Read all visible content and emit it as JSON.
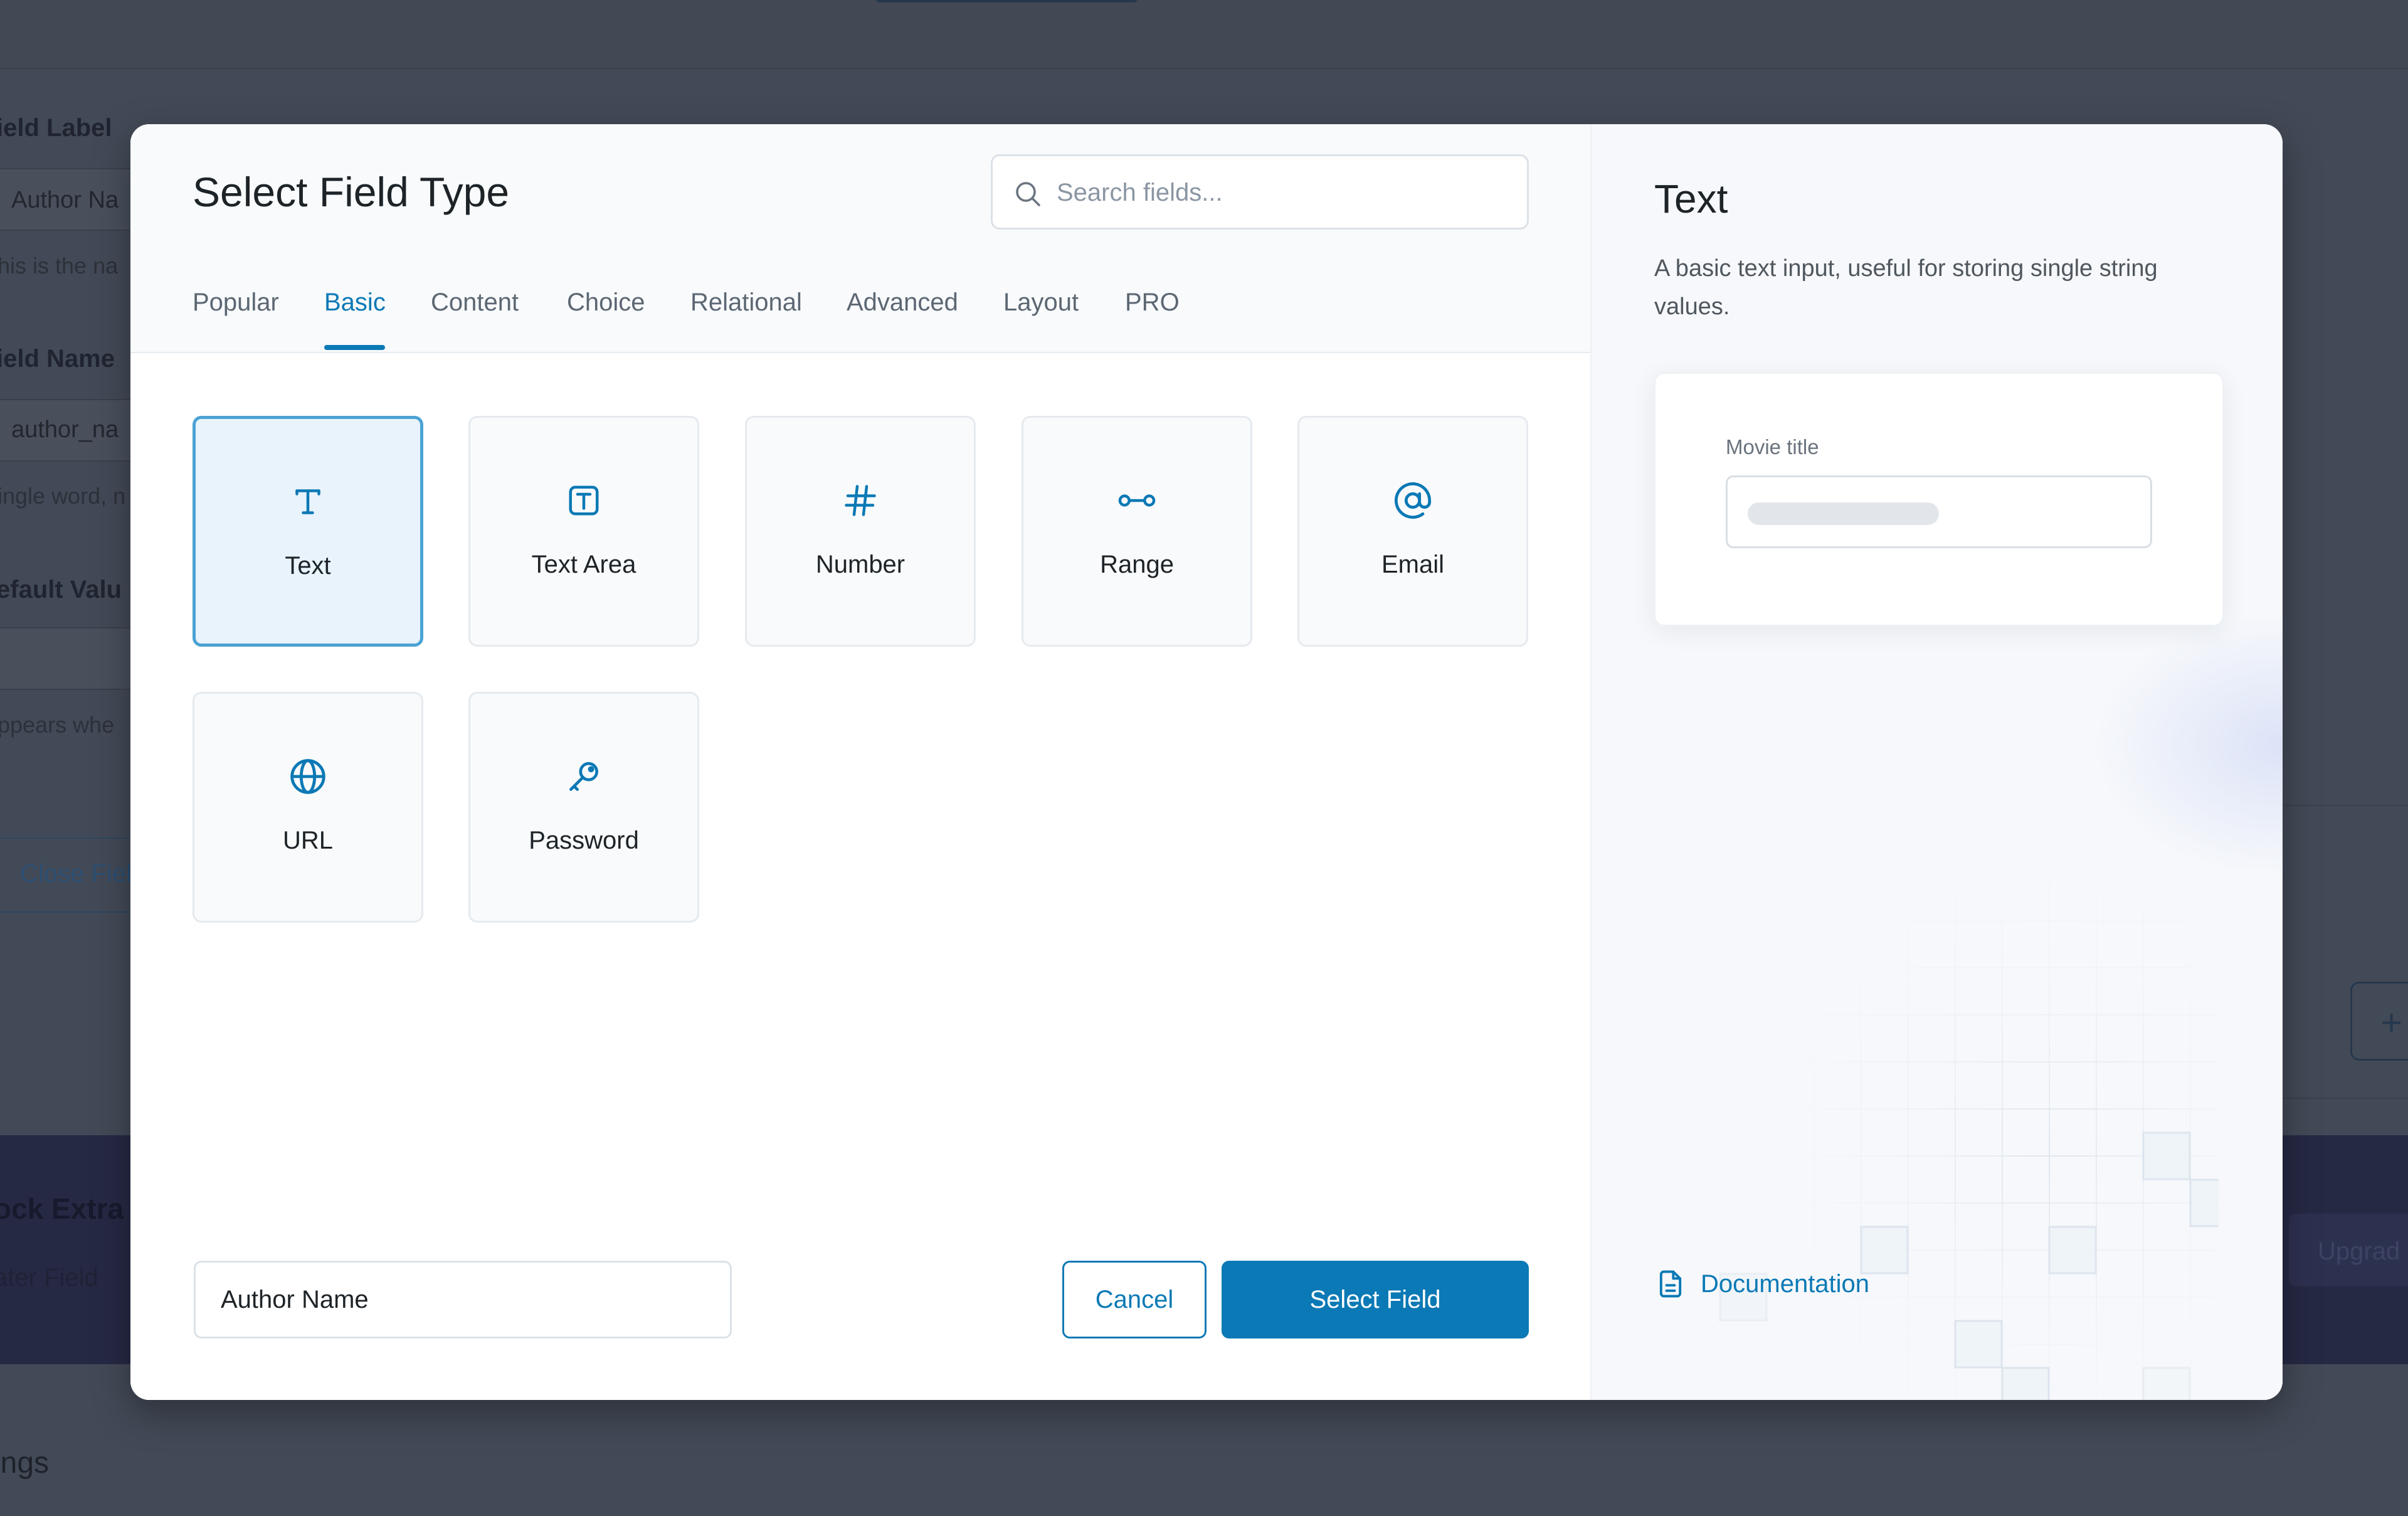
{
  "background": {
    "labels": {
      "field_label": "ield Label",
      "field_label_value": "Author Na",
      "field_label_help": "his is the na",
      "field_name": "ield Name",
      "field_name_value": "author_na",
      "field_name_help": "ingle word, n",
      "default_value": "efault Valu",
      "default_value_help": "ppears whe",
      "close_field": "Close Fiel",
      "band_title": "ock Extra F",
      "band_sub": "ater Field",
      "upgrade": "Upgrad",
      "plus": "+",
      "bottom": "ings"
    }
  },
  "modal": {
    "title": "Select Field Type",
    "search": {
      "placeholder": "Search fields..."
    },
    "tabs": [
      {
        "label": "Popular"
      },
      {
        "label": "Basic"
      },
      {
        "label": "Content"
      },
      {
        "label": "Choice"
      },
      {
        "label": "Relational"
      },
      {
        "label": "Advanced"
      },
      {
        "label": "Layout"
      },
      {
        "label": "PRO"
      }
    ],
    "active_tab": "Basic",
    "fields": [
      {
        "label": "Text",
        "icon": "text-icon",
        "selected": true
      },
      {
        "label": "Text Area",
        "icon": "textarea-icon"
      },
      {
        "label": "Number",
        "icon": "hash-icon"
      },
      {
        "label": "Range",
        "icon": "range-icon"
      },
      {
        "label": "Email",
        "icon": "at-icon"
      },
      {
        "label": "URL",
        "icon": "globe-icon"
      },
      {
        "label": "Password",
        "icon": "key-icon"
      }
    ],
    "footer": {
      "field_label_value": "Author Name",
      "cancel": "Cancel",
      "select": "Select Field"
    },
    "preview": {
      "title": "Text",
      "description": "A basic text input, useful for storing single string values.",
      "sample_label": "Movie title",
      "doc_link": "Documentation",
      "doc_icon": "document-icon"
    }
  },
  "colors": {
    "accent": "#0b79b5",
    "selected_border": "#4ba3d3",
    "selected_bg": "#e8f3fb",
    "overlay": "#434a57"
  }
}
